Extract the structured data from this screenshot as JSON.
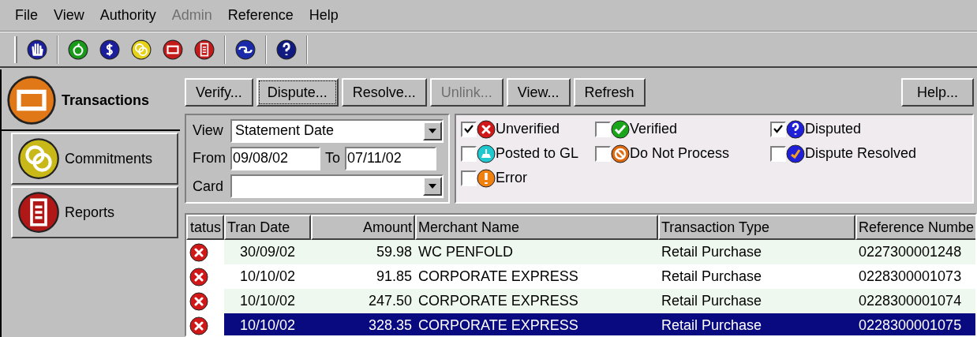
{
  "menu": [
    {
      "label": "File",
      "disabled": false
    },
    {
      "label": "View",
      "disabled": false
    },
    {
      "label": "Authority",
      "disabled": false
    },
    {
      "label": "Admin",
      "disabled": true
    },
    {
      "label": "Reference",
      "disabled": false
    },
    {
      "label": "Help",
      "disabled": false
    }
  ],
  "sidebar": {
    "items": [
      {
        "label": "Transactions",
        "selected": true
      },
      {
        "label": "Commitments",
        "selected": false
      },
      {
        "label": "Reports",
        "selected": false
      }
    ]
  },
  "actions": [
    {
      "label": "Verify...",
      "disabled": false,
      "focused": false
    },
    {
      "label": "Dispute...",
      "disabled": false,
      "focused": true
    },
    {
      "label": "Resolve...",
      "disabled": false,
      "focused": false
    },
    {
      "label": "Unlink...",
      "disabled": true,
      "focused": false
    },
    {
      "label": "View...",
      "disabled": false,
      "focused": false
    },
    {
      "label": "Refresh",
      "disabled": false,
      "focused": false
    }
  ],
  "help_button": "Help...",
  "filters": {
    "view_label": "View",
    "view_value": "Statement Date",
    "from_label": "From",
    "from_value": "09/08/02",
    "to_label": "To",
    "to_value": "07/11/02",
    "card_label": "Card"
  },
  "statuses": [
    {
      "label": "Unverified",
      "checked": true
    },
    {
      "label": "Verified",
      "checked": false
    },
    {
      "label": "Disputed",
      "checked": true
    },
    {
      "label": "Posted to GL",
      "checked": false
    },
    {
      "label": "Do Not Process",
      "checked": false
    },
    {
      "label": "Dispute Resolved",
      "checked": false
    },
    {
      "label": "Error",
      "checked": false
    }
  ],
  "table": {
    "columns": [
      "tatus",
      "Tran Date",
      "Amount",
      "Merchant Name",
      "Transaction Type",
      "Reference Numbe"
    ],
    "rows": [
      {
        "date": "30/09/02",
        "amount": "59.98",
        "merchant": "WC PENFOLD",
        "type": "Retail Purchase",
        "reference": "0227300001248",
        "selected": false
      },
      {
        "date": "10/10/02",
        "amount": "91.85",
        "merchant": "CORPORATE EXPRESS",
        "type": "Retail Purchase",
        "reference": "0228300001073",
        "selected": false
      },
      {
        "date": "10/10/02",
        "amount": "247.50",
        "merchant": "CORPORATE EXPRESS",
        "type": "Retail Purchase",
        "reference": "0228300001074",
        "selected": false
      },
      {
        "date": "10/10/02",
        "amount": "328.35",
        "merchant": "CORPORATE EXPRESS",
        "type": "Retail Purchase",
        "reference": "0228300001075",
        "selected": true
      }
    ]
  }
}
